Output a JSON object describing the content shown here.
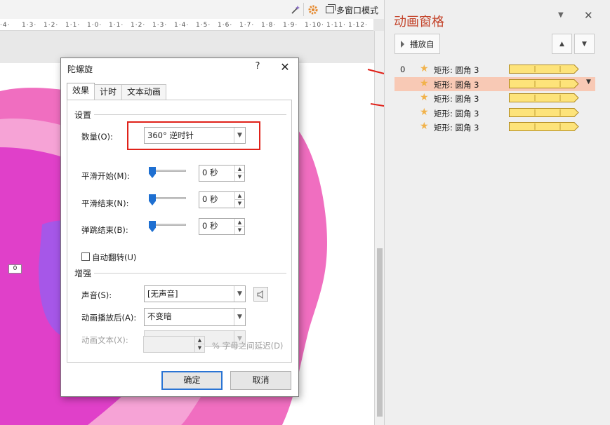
{
  "toolbar": {
    "multi_window_label": "多窗口模式",
    "icons": [
      "wand-icon",
      "settings-gear-icon",
      "multi-window-icon"
    ]
  },
  "ruler": {
    "marks": [
      "·4·",
      "1·3·",
      "1·2·",
      "1·1·",
      "1·0·",
      "1·1·",
      "1·2·",
      "1·3·",
      "1·4·",
      "1·5·",
      "1·6·",
      "1·7·",
      "1·8·",
      "1·9·",
      "1·10·",
      "1·11·",
      "1·12·"
    ]
  },
  "slide": {
    "number_box": "0",
    "colors": {
      "pink": "#f06ec0",
      "magenta": "#e040c9",
      "violet": "#a657e8",
      "light_pink": "#f6a3d6"
    }
  },
  "dialog": {
    "title": "陀螺旋",
    "help": "?",
    "close": "✕",
    "tabs": [
      "效果",
      "计时",
      "文本动画"
    ],
    "settings_group": "设置",
    "amount_label": "数量(O):",
    "amount_value": "360° 逆时针",
    "smooth_start_label": "平滑开始(M):",
    "smooth_start_value": "0 秒",
    "smooth_end_label": "平滑结束(N):",
    "smooth_end_value": "0 秒",
    "bounce_end_label": "弹跳结束(B):",
    "bounce_end_value": "0 秒",
    "auto_reverse_label": "自动翻转(U)",
    "enhance_group": "增强",
    "sound_label": "声音(S):",
    "sound_value": "[无声音]",
    "after_anim_label": "动画播放后(A):",
    "after_anim_value": "不变暗",
    "anim_text_label": "动画文本(X):",
    "anim_text_value": "",
    "letter_delay_label": "% 字母之间延迟(D)",
    "ok": "确定",
    "cancel": "取消"
  },
  "pane": {
    "title": "动画窗格",
    "play_label": "播放自",
    "title_color": "#c4452c",
    "selected_color": "#f8c9b5",
    "bar_color": "#fde37a",
    "items": [
      {
        "index": "0",
        "name": "矩形: 圆角 3"
      },
      {
        "index": "",
        "name": "矩形: 圆角 3"
      },
      {
        "index": "",
        "name": "矩形: 圆角 3"
      },
      {
        "index": "",
        "name": "矩形: 圆角 3"
      },
      {
        "index": "",
        "name": "矩形: 圆角 3"
      }
    ],
    "selected_index": 1
  },
  "annotation": {
    "arrow_color": "#e0221a",
    "highlight_color": "#e0221a"
  }
}
